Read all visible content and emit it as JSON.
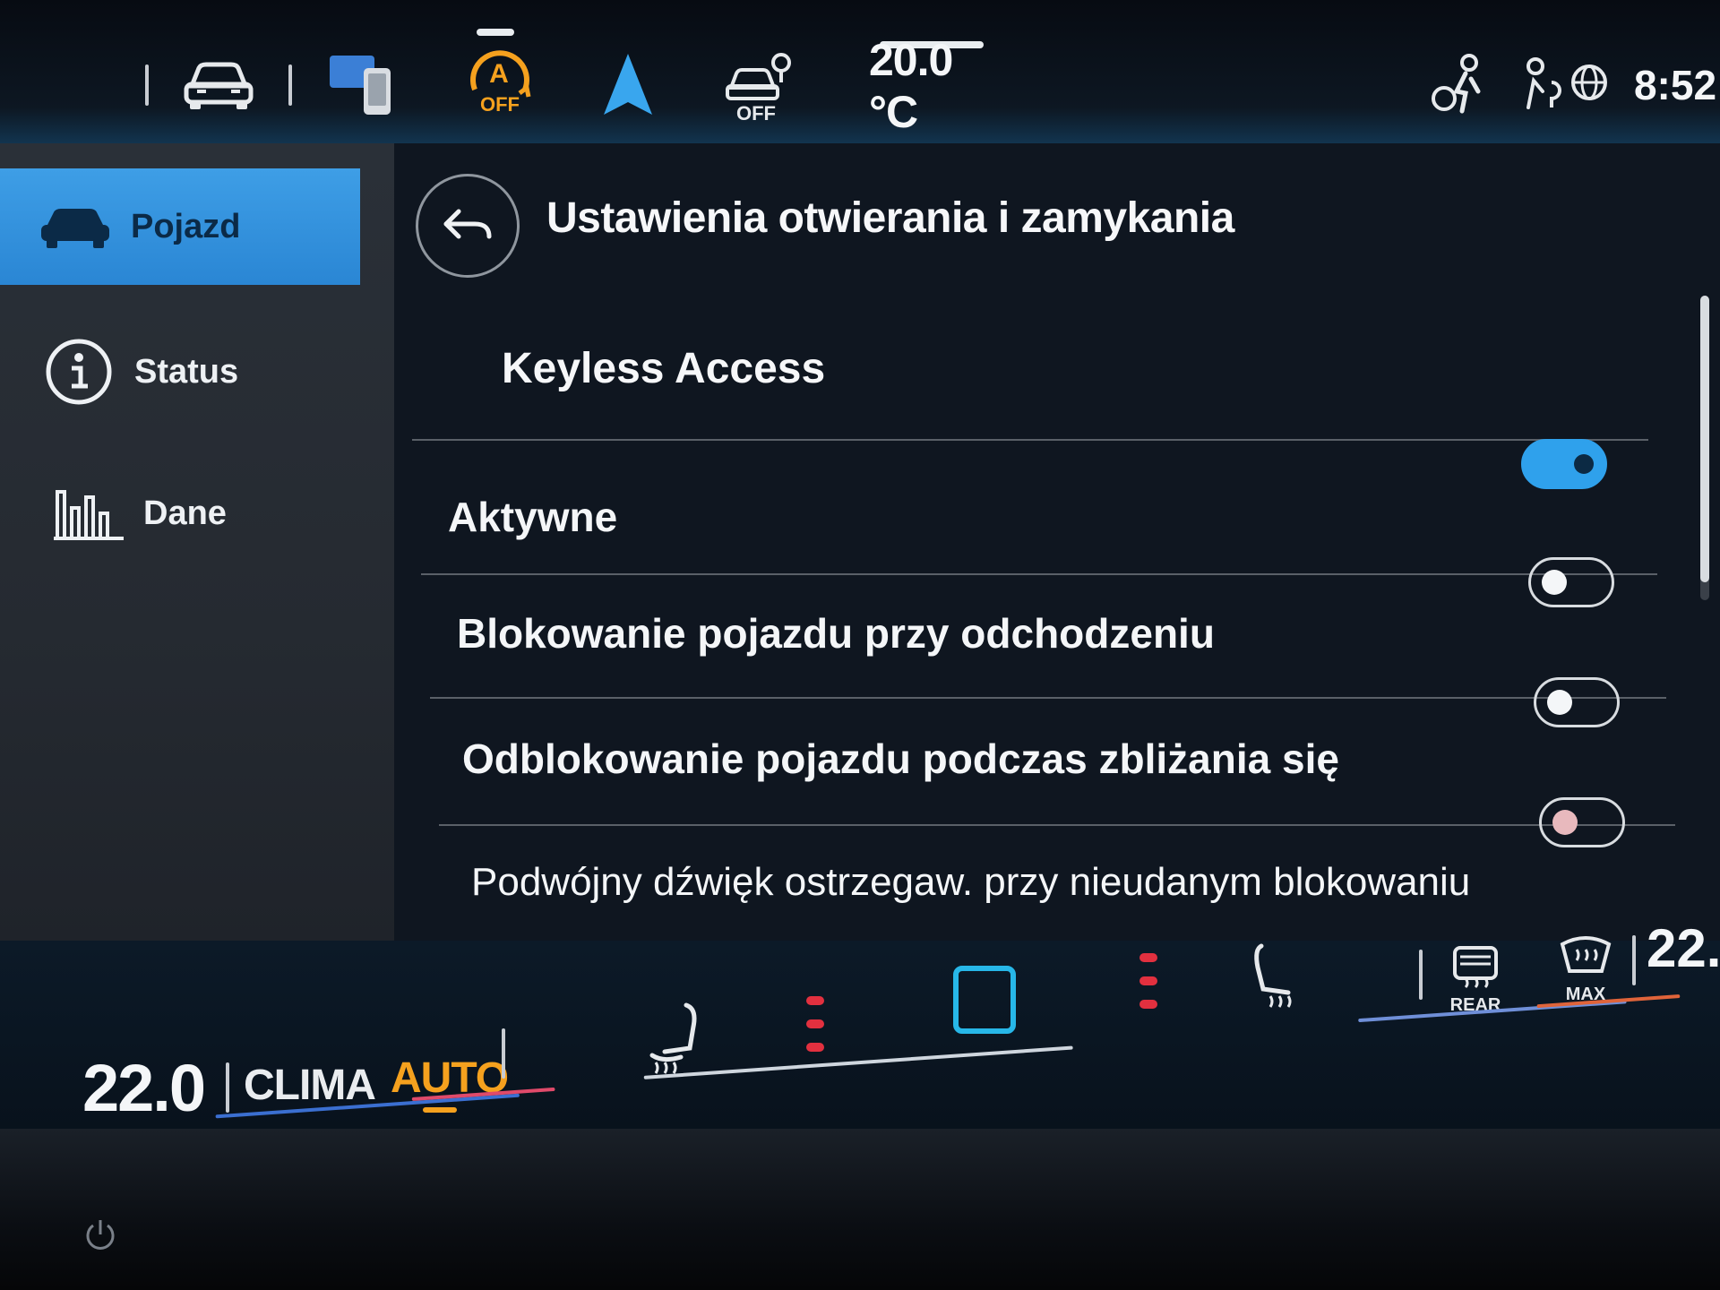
{
  "topbar": {
    "temperature": "20.0 °C",
    "time": "8:52",
    "icons": [
      "apps-grid-icon",
      "car-icon",
      "phone-projection-icon",
      "auto-hold-off-icon",
      "navigation-icon",
      "assist-off-icon",
      "person-profile-icon",
      "location-person-icon",
      "globe-icon"
    ],
    "auto_hold_label": "OFF",
    "assist_label": "OFF"
  },
  "sidebar": {
    "items": [
      {
        "label": "Pojazd",
        "icon": "car-icon",
        "active": true
      },
      {
        "label": "Status",
        "icon": "info-icon",
        "active": false
      },
      {
        "label": "Dane",
        "icon": "bar-chart-icon",
        "active": false
      }
    ]
  },
  "main": {
    "title": "Ustawienia otwierania i zamykania",
    "section": "Keyless Access",
    "rows": [
      {
        "label": "Aktywne",
        "on": true
      },
      {
        "label": "Blokowanie pojazdu przy odchodzeniu",
        "on": false
      },
      {
        "label": "Odblokowanie pojazdu podczas zbliżania się",
        "on": false
      },
      {
        "label": "Podwójny dźwięk ostrzegaw. przy nieudanym blokowaniu",
        "on": false
      }
    ]
  },
  "climate": {
    "left_temp": "22.0",
    "clima_label": "CLIMA",
    "auto_label": "AUTO",
    "right_temp": "22.",
    "rear_label": "REAR",
    "max_label": "MAX"
  },
  "colors": {
    "accent_blue": "#2fa1ec",
    "auto_orange": "#f5a11e",
    "heat_red": "#e2303f",
    "home_cyan": "#27b7e8"
  }
}
